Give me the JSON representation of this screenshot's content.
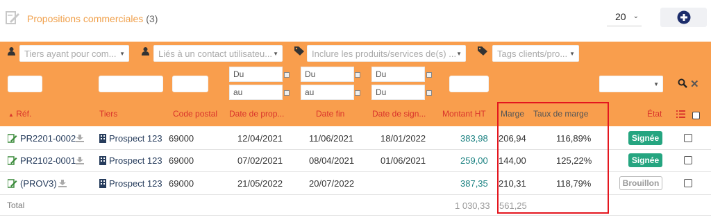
{
  "header": {
    "title": "Propositions commerciales",
    "count": "(3)",
    "limit": "20",
    "add_icon": "plus-circle-icon"
  },
  "filters": {
    "tiers_placeholder": "Tiers ayant pour com...",
    "contact_placeholder": "Liés à un contact utilisateu...",
    "products_placeholder": "Inclure les produits/services de(s) ...",
    "tags_placeholder": "Tags clients/pro...",
    "date_from": "Du",
    "date_to": "au"
  },
  "columns": {
    "ref": "Réf.",
    "tiers": "Tiers",
    "cp": "Code postal",
    "date_prop": "Date de prop...",
    "date_fin": "Date fin",
    "date_sign": "Date de sign...",
    "montant": "Montant HT",
    "marge": "Marge",
    "taux": "Taux de marge",
    "etat": "État"
  },
  "rows": [
    {
      "ref": "PR2201-0002",
      "tiers": "Prospect 123",
      "cp": "69000",
      "date_prop": "12/04/2021",
      "date_fin": "11/06/2021",
      "date_sign": "18/01/2022",
      "montant": "383,98",
      "marge": "206,94",
      "taux": "116,89%",
      "etat": "Signée"
    },
    {
      "ref": "PR2102-0001",
      "tiers": "Prospect 123",
      "cp": "69000",
      "date_prop": "07/02/2021",
      "date_fin": "08/04/2021",
      "date_sign": "01/06/2021",
      "montant": "259,00",
      "marge": "144,00",
      "taux": "125,22%",
      "etat": "Signée"
    },
    {
      "ref": "(PROV3)",
      "tiers": "Prospect 123",
      "cp": "69000",
      "date_prop": "21/05/2022",
      "date_fin": "20/07/2022",
      "date_sign": "",
      "montant": "387,35",
      "marge": "210,31",
      "taux": "118,79%",
      "etat": "Brouillon"
    }
  ],
  "total": {
    "label": "Total",
    "montant": "1 030,33",
    "marge": "561,25"
  },
  "colors": {
    "orange": "#f99e4d",
    "accent_red": "#d9332b",
    "signed_green": "#25a580",
    "highlight": "#e4161e"
  }
}
